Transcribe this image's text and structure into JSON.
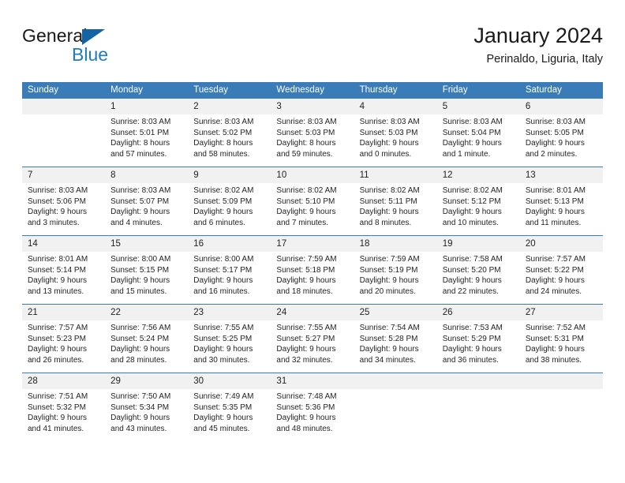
{
  "brand": {
    "name_top": "General",
    "name_bottom": "Blue",
    "triangle_color": "#1464a5",
    "blue_color": "#1e7bc4"
  },
  "header": {
    "title": "January 2024",
    "subtitle": "Perinaldo, Liguria, Italy",
    "header_bg": "#3a7cb8",
    "daynum_bg": "#f1f1f1"
  },
  "calendar": {
    "weekday_headers": [
      "Sunday",
      "Monday",
      "Tuesday",
      "Wednesday",
      "Thursday",
      "Friday",
      "Saturday"
    ],
    "weeks": [
      [
        {
          "day": "",
          "sunrise": "",
          "sunset": "",
          "daylight_1": "",
          "daylight_2": ""
        },
        {
          "day": "1",
          "sunrise": "Sunrise: 8:03 AM",
          "sunset": "Sunset: 5:01 PM",
          "daylight_1": "Daylight: 8 hours",
          "daylight_2": "and 57 minutes."
        },
        {
          "day": "2",
          "sunrise": "Sunrise: 8:03 AM",
          "sunset": "Sunset: 5:02 PM",
          "daylight_1": "Daylight: 8 hours",
          "daylight_2": "and 58 minutes."
        },
        {
          "day": "3",
          "sunrise": "Sunrise: 8:03 AM",
          "sunset": "Sunset: 5:03 PM",
          "daylight_1": "Daylight: 8 hours",
          "daylight_2": "and 59 minutes."
        },
        {
          "day": "4",
          "sunrise": "Sunrise: 8:03 AM",
          "sunset": "Sunset: 5:03 PM",
          "daylight_1": "Daylight: 9 hours",
          "daylight_2": "and 0 minutes."
        },
        {
          "day": "5",
          "sunrise": "Sunrise: 8:03 AM",
          "sunset": "Sunset: 5:04 PM",
          "daylight_1": "Daylight: 9 hours",
          "daylight_2": "and 1 minute."
        },
        {
          "day": "6",
          "sunrise": "Sunrise: 8:03 AM",
          "sunset": "Sunset: 5:05 PM",
          "daylight_1": "Daylight: 9 hours",
          "daylight_2": "and 2 minutes."
        }
      ],
      [
        {
          "day": "7",
          "sunrise": "Sunrise: 8:03 AM",
          "sunset": "Sunset: 5:06 PM",
          "daylight_1": "Daylight: 9 hours",
          "daylight_2": "and 3 minutes."
        },
        {
          "day": "8",
          "sunrise": "Sunrise: 8:03 AM",
          "sunset": "Sunset: 5:07 PM",
          "daylight_1": "Daylight: 9 hours",
          "daylight_2": "and 4 minutes."
        },
        {
          "day": "9",
          "sunrise": "Sunrise: 8:02 AM",
          "sunset": "Sunset: 5:09 PM",
          "daylight_1": "Daylight: 9 hours",
          "daylight_2": "and 6 minutes."
        },
        {
          "day": "10",
          "sunrise": "Sunrise: 8:02 AM",
          "sunset": "Sunset: 5:10 PM",
          "daylight_1": "Daylight: 9 hours",
          "daylight_2": "and 7 minutes."
        },
        {
          "day": "11",
          "sunrise": "Sunrise: 8:02 AM",
          "sunset": "Sunset: 5:11 PM",
          "daylight_1": "Daylight: 9 hours",
          "daylight_2": "and 8 minutes."
        },
        {
          "day": "12",
          "sunrise": "Sunrise: 8:02 AM",
          "sunset": "Sunset: 5:12 PM",
          "daylight_1": "Daylight: 9 hours",
          "daylight_2": "and 10 minutes."
        },
        {
          "day": "13",
          "sunrise": "Sunrise: 8:01 AM",
          "sunset": "Sunset: 5:13 PM",
          "daylight_1": "Daylight: 9 hours",
          "daylight_2": "and 11 minutes."
        }
      ],
      [
        {
          "day": "14",
          "sunrise": "Sunrise: 8:01 AM",
          "sunset": "Sunset: 5:14 PM",
          "daylight_1": "Daylight: 9 hours",
          "daylight_2": "and 13 minutes."
        },
        {
          "day": "15",
          "sunrise": "Sunrise: 8:00 AM",
          "sunset": "Sunset: 5:15 PM",
          "daylight_1": "Daylight: 9 hours",
          "daylight_2": "and 15 minutes."
        },
        {
          "day": "16",
          "sunrise": "Sunrise: 8:00 AM",
          "sunset": "Sunset: 5:17 PM",
          "daylight_1": "Daylight: 9 hours",
          "daylight_2": "and 16 minutes."
        },
        {
          "day": "17",
          "sunrise": "Sunrise: 7:59 AM",
          "sunset": "Sunset: 5:18 PM",
          "daylight_1": "Daylight: 9 hours",
          "daylight_2": "and 18 minutes."
        },
        {
          "day": "18",
          "sunrise": "Sunrise: 7:59 AM",
          "sunset": "Sunset: 5:19 PM",
          "daylight_1": "Daylight: 9 hours",
          "daylight_2": "and 20 minutes."
        },
        {
          "day": "19",
          "sunrise": "Sunrise: 7:58 AM",
          "sunset": "Sunset: 5:20 PM",
          "daylight_1": "Daylight: 9 hours",
          "daylight_2": "and 22 minutes."
        },
        {
          "day": "20",
          "sunrise": "Sunrise: 7:57 AM",
          "sunset": "Sunset: 5:22 PM",
          "daylight_1": "Daylight: 9 hours",
          "daylight_2": "and 24 minutes."
        }
      ],
      [
        {
          "day": "21",
          "sunrise": "Sunrise: 7:57 AM",
          "sunset": "Sunset: 5:23 PM",
          "daylight_1": "Daylight: 9 hours",
          "daylight_2": "and 26 minutes."
        },
        {
          "day": "22",
          "sunrise": "Sunrise: 7:56 AM",
          "sunset": "Sunset: 5:24 PM",
          "daylight_1": "Daylight: 9 hours",
          "daylight_2": "and 28 minutes."
        },
        {
          "day": "23",
          "sunrise": "Sunrise: 7:55 AM",
          "sunset": "Sunset: 5:25 PM",
          "daylight_1": "Daylight: 9 hours",
          "daylight_2": "and 30 minutes."
        },
        {
          "day": "24",
          "sunrise": "Sunrise: 7:55 AM",
          "sunset": "Sunset: 5:27 PM",
          "daylight_1": "Daylight: 9 hours",
          "daylight_2": "and 32 minutes."
        },
        {
          "day": "25",
          "sunrise": "Sunrise: 7:54 AM",
          "sunset": "Sunset: 5:28 PM",
          "daylight_1": "Daylight: 9 hours",
          "daylight_2": "and 34 minutes."
        },
        {
          "day": "26",
          "sunrise": "Sunrise: 7:53 AM",
          "sunset": "Sunset: 5:29 PM",
          "daylight_1": "Daylight: 9 hours",
          "daylight_2": "and 36 minutes."
        },
        {
          "day": "27",
          "sunrise": "Sunrise: 7:52 AM",
          "sunset": "Sunset: 5:31 PM",
          "daylight_1": "Daylight: 9 hours",
          "daylight_2": "and 38 minutes."
        }
      ],
      [
        {
          "day": "28",
          "sunrise": "Sunrise: 7:51 AM",
          "sunset": "Sunset: 5:32 PM",
          "daylight_1": "Daylight: 9 hours",
          "daylight_2": "and 41 minutes."
        },
        {
          "day": "29",
          "sunrise": "Sunrise: 7:50 AM",
          "sunset": "Sunset: 5:34 PM",
          "daylight_1": "Daylight: 9 hours",
          "daylight_2": "and 43 minutes."
        },
        {
          "day": "30",
          "sunrise": "Sunrise: 7:49 AM",
          "sunset": "Sunset: 5:35 PM",
          "daylight_1": "Daylight: 9 hours",
          "daylight_2": "and 45 minutes."
        },
        {
          "day": "31",
          "sunrise": "Sunrise: 7:48 AM",
          "sunset": "Sunset: 5:36 PM",
          "daylight_1": "Daylight: 9 hours",
          "daylight_2": "and 48 minutes."
        },
        {
          "day": "",
          "sunrise": "",
          "sunset": "",
          "daylight_1": "",
          "daylight_2": ""
        },
        {
          "day": "",
          "sunrise": "",
          "sunset": "",
          "daylight_1": "",
          "daylight_2": ""
        },
        {
          "day": "",
          "sunrise": "",
          "sunset": "",
          "daylight_1": "",
          "daylight_2": ""
        }
      ]
    ]
  }
}
